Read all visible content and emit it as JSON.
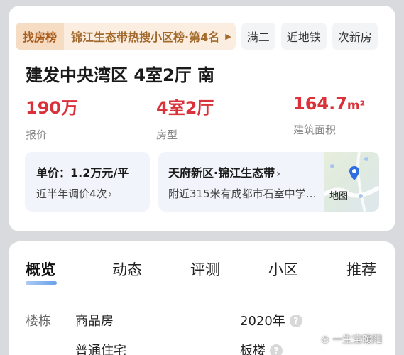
{
  "tags": {
    "rank_head": "找房榜",
    "rank_text": "锦江生态带热搜小区榜·第4名",
    "chips": [
      "满二",
      "近地铁",
      "次新房"
    ]
  },
  "title": "建发中央湾区 4室2厅 南",
  "stats": {
    "price": {
      "value": "190万",
      "label": "报价"
    },
    "layout": {
      "value": "4室2厅",
      "label": "房型"
    },
    "area": {
      "value": "164.7",
      "unit": "m²",
      "label": "建筑面积"
    }
  },
  "unit_price": {
    "line1": "单价：1.2万元/平",
    "line2": "近半年调价4次"
  },
  "location": {
    "line1": "天府新区·锦江生态带",
    "line2": "附近315米有成都市石室中学…",
    "map_label": "地图"
  },
  "tabs": [
    "概览",
    "动态",
    "评测",
    "小区",
    "推荐"
  ],
  "info": {
    "building_key": "楼栋",
    "type1": "商品房",
    "type2": "普通住宅",
    "year": "2020年",
    "structure": "板楼",
    "q_mark": "?"
  },
  "watermark": "⊙ 一生宝暖阳",
  "colors": {
    "price_red": "#d9323a",
    "rank_brown": "#a75a1a",
    "accent_blue": "#4e8fe6"
  }
}
